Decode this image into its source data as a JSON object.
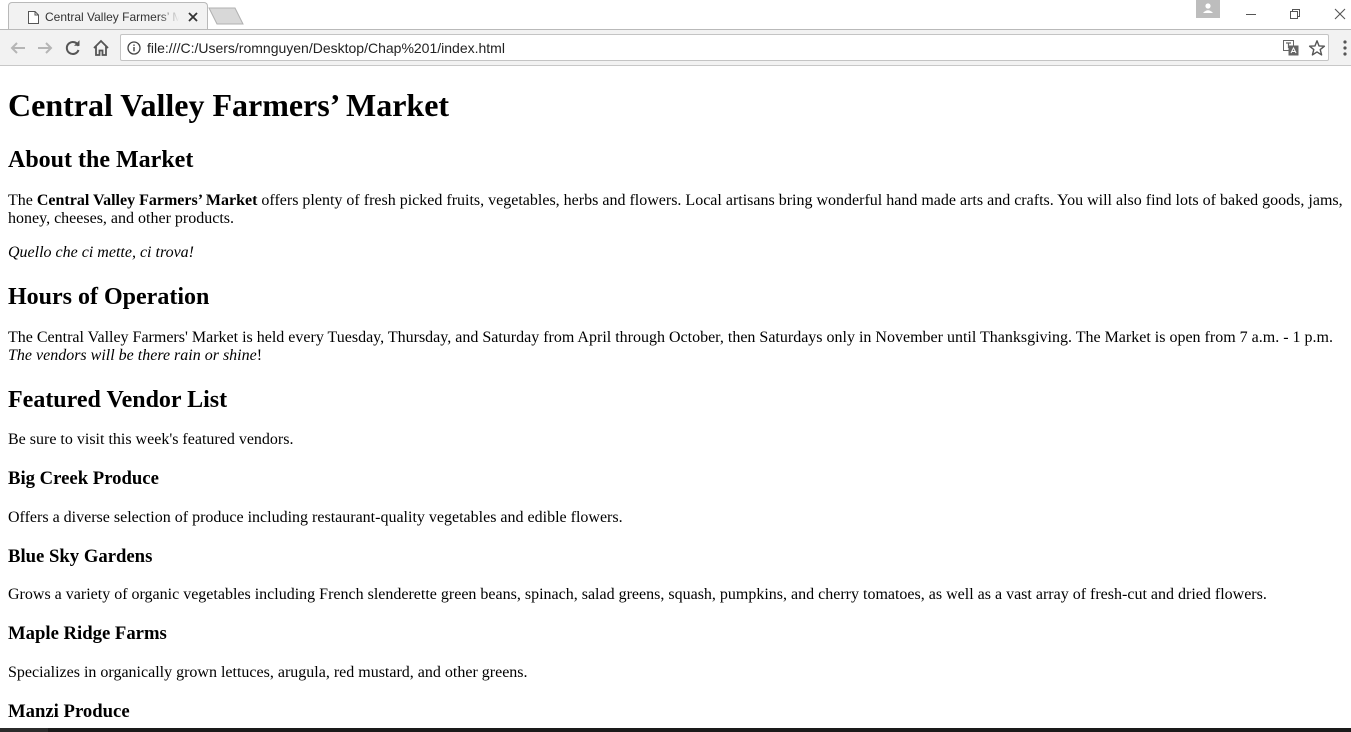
{
  "browser": {
    "tab": {
      "title": "Central Valley Farmers’ Market"
    },
    "address": {
      "url": "file:///C:/Users/romnguyen/Desktop/Chap%201/index.html"
    }
  },
  "page": {
    "title": "Central Valley Farmers’ Market",
    "about": {
      "heading": "About the Market",
      "intro_prefix": "The ",
      "intro_bold": "Central Valley Farmers’ Market",
      "intro_rest": " offers plenty of fresh picked fruits, vegetables, herbs and flowers. Local artisans bring wonderful hand made arts and crafts. You will also find lots of baked goods, jams, honey, cheeses, and other products.",
      "motto": "Quello che ci mette, ci trova!"
    },
    "hours": {
      "heading": "Hours of Operation",
      "text": "The Central Valley Farmers' Market is held every Tuesday, Thursday, and Saturday from April through October, then Saturdays only in November until Thanksgiving. The Market is open from 7 a.m. - 1 p.m.",
      "italic_note": "The vendors will be there rain or shine",
      "note_end": "!"
    },
    "vendors": {
      "heading": "Featured Vendor List",
      "intro": "Be sure to visit this week's featured vendors.",
      "items": [
        {
          "name": "Big Creek Produce",
          "description": "Offers a diverse selection of produce including restaurant-quality vegetables and edible flowers."
        },
        {
          "name": "Blue Sky Gardens",
          "description": "Grows a variety of organic vegetables including French slenderette green beans, spinach, salad greens, squash, pumpkins, and cherry tomatoes, as well as a vast array of fresh-cut and dried flowers."
        },
        {
          "name": "Maple Ridge Farms",
          "description": "Specializes in organically grown lettuces, arugula, red mustard, and other greens."
        },
        {
          "name": "Manzi Produce",
          "description": ""
        }
      ]
    }
  }
}
